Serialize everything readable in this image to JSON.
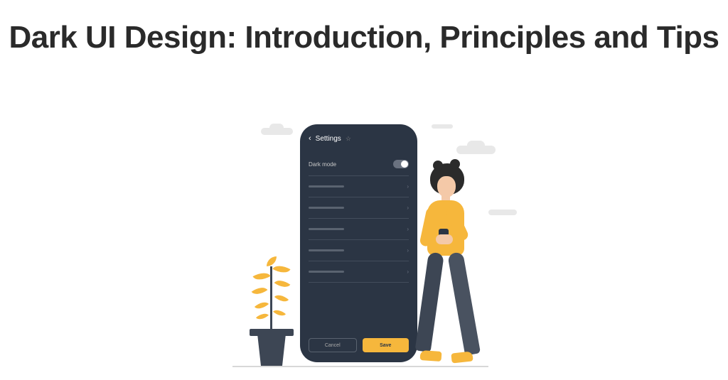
{
  "title": "Dark UI Design: Introduction, Principles and Tips",
  "phone": {
    "header_label": "Settings",
    "dark_mode_label": "Dark mode",
    "cancel_label": "Cancel",
    "save_label": "Save"
  },
  "colors": {
    "accent": "#f6b73c",
    "phone_bg": "#2b3544",
    "text_dark": "#2a2a2a"
  }
}
